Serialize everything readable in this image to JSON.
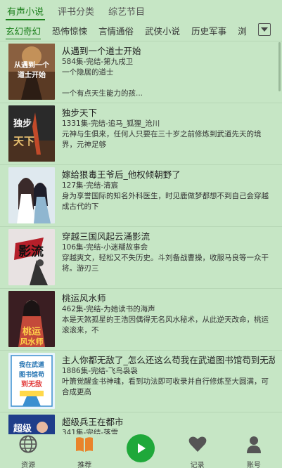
{
  "top_tabs": [
    "有声小说",
    "评书分类",
    "综艺节目"
  ],
  "category_tabs": [
    "玄幻奇幻",
    "恐怖惊悚",
    "言情通俗",
    "武侠小说",
    "历史军事",
    "浏"
  ],
  "books": [
    {
      "title": "从遇到一个道士开始",
      "meta": "584集-完结-第九戌卫",
      "desc": "一个隐居的道士\n\n一个有点天生能力的孩...",
      "cover_text": "从遇到一个道士开始"
    },
    {
      "title": "独步天下",
      "meta": "1331集-完结-追马_狐狸_沧川",
      "desc": "元神与生俱来，任何人只要在三十岁之前修炼到武道先天的境界，元神足够",
      "cover_text": "独步天下"
    },
    {
      "title": "嫁给狠毒王爷后_他权倾朝野了",
      "meta": "127集-完结-清宸",
      "desc": "身为享誉国际的知名外科医生，时见鹿做梦都想不到自己会穿越成古代的下",
      "cover_text": ""
    },
    {
      "title": "穿越三国风起云涌影流",
      "meta": "106集-完结-小迷糊故事会",
      "desc": "穿越爽文，轻松又不失历史。斗刘备战曹操，收服马良等一众干将。游刃三",
      "cover_text": "影流"
    },
    {
      "title": "桃运风水师",
      "meta": "462集-完结-为她读书的海声",
      "desc": "本是天煞孤星的王浩因偶得无名风水秘术，从此逆天改命，桃运滚滚来，不",
      "cover_text": "桃运风水师"
    },
    {
      "title": "主人你都无敌了_怎么还这么苟我在武道图书馆苟到无敌",
      "meta": "1886集-完结-飞鸟袅袅",
      "desc": "叶箫觉醒金书神魂，看到功法即可收录并自行修炼至大圆满，可合成更高",
      "cover_text": "我在武道图书馆苟到无敌"
    },
    {
      "title": "超级兵王在都市",
      "meta": "341集-完结-落雪",
      "desc": "",
      "cover_text": "超级"
    }
  ],
  "bottom_nav": [
    {
      "label": "资源",
      "icon": "globe-icon"
    },
    {
      "label": "推荐",
      "icon": "book-icon"
    },
    {
      "label": "",
      "icon": "play-icon"
    },
    {
      "label": "记录",
      "icon": "heart-icon"
    },
    {
      "label": "账号",
      "icon": "user-icon"
    }
  ],
  "colors": {
    "background": "#c6e6c5",
    "accent": "#1a7f1a",
    "play_button": "#1fa83a",
    "recommend_icon": "#e9832a"
  }
}
